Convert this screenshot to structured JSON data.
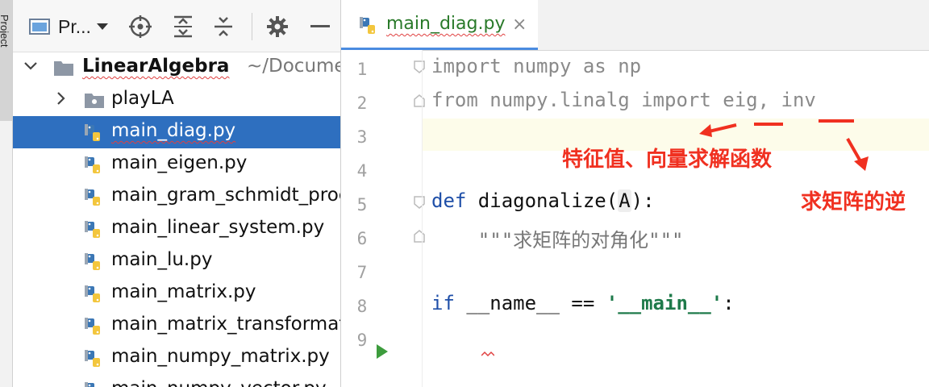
{
  "sidebar_stripe": {
    "label": "Project"
  },
  "project_panel": {
    "title": "Pr...",
    "icons": [
      "panel-view-icon",
      "chevron-down-icon",
      "locate-target-icon",
      "expand-all-icon",
      "collapse-all-icon",
      "gear-icon",
      "minimize-icon"
    ],
    "root": {
      "name": "LinearAlgebra",
      "path": "~/Documents"
    },
    "items": [
      {
        "label": "playLA",
        "type": "folder"
      },
      {
        "label": "main_diag.py",
        "type": "python",
        "selected": true
      },
      {
        "label": "main_eigen.py",
        "type": "python"
      },
      {
        "label": "main_gram_schmidt_process.py",
        "type": "python"
      },
      {
        "label": "main_linear_system.py",
        "type": "python"
      },
      {
        "label": "main_lu.py",
        "type": "python"
      },
      {
        "label": "main_matrix.py",
        "type": "python"
      },
      {
        "label": "main_matrix_transformation.py",
        "type": "python"
      },
      {
        "label": "main_numpy_matrix.py",
        "type": "python"
      },
      {
        "label": "main_numpy_vector.py",
        "type": "python"
      }
    ]
  },
  "editor": {
    "tab": {
      "label": "main_diag.py",
      "close": "×"
    },
    "line_numbers": [
      "1",
      "2",
      "3",
      "4",
      "5",
      "6",
      "7",
      "8",
      "9"
    ],
    "code": {
      "l1_kw1": "import",
      "l1_rest": " numpy as np",
      "l2_kw1": "from",
      "l2_mid": " numpy.linalg ",
      "l2_kw2": "import",
      "l2_rest": " eig, inv",
      "l5_kw": "def",
      "l5_name": " diagonalize(",
      "l5_param": "A",
      "l5_end": "):",
      "l6": "    \"\"\"求矩阵的对角化\"\"\"",
      "l8_kw": "if",
      "l8_mid": " __name__ == ",
      "l8_str": "'__main__'",
      "l8_end": ":"
    }
  },
  "annotations": {
    "eig_note": "特征值、向量求解函数",
    "inv_note": "求矩阵的逆",
    "color": "#f03020"
  }
}
